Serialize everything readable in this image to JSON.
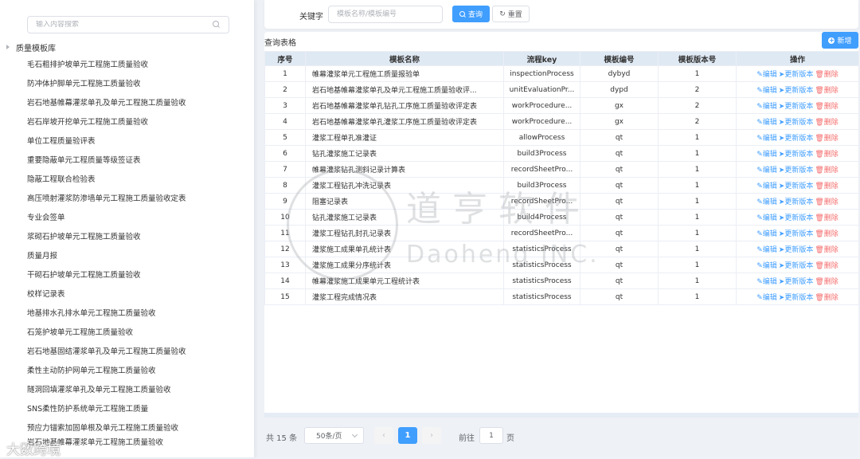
{
  "tree": {
    "search_placeholder": "输入内容搜索",
    "root_label": "质量模板库",
    "items": [
      "毛石粗排护坡单元工程施工质量验收",
      "防冲体护脚单元工程施工质量验收",
      "岩石地基帷幕灌浆单孔及单元工程施工质量验收",
      "岩石岸坡开挖单元工程施工质量验收",
      "单位工程质量验评表",
      "重要隐蔽单元工程质量等级签证表",
      "隐蔽工程联合检验表",
      "高压喷射灌浆防渗墙单元工程施工质量验收定表",
      "专业会签单",
      "浆砌石护坡单元工程施工质量验收",
      "质量月报",
      "干砌石护坡单元工程施工质量验收",
      "校样记录表",
      "地基排水孔排水单元工程施工质量验收",
      "石笼护坡单元工程施工质量验收",
      "岩石地基固结灌浆单孔及单元工程施工质量验收",
      "柔性主动防护网单元工程施工质量验收",
      "隧洞回填灌浆单孔及单元工程施工质量验收",
      "SNS柔性防护系统单元工程施工质量",
      "预应力锚索加固单根及单元工程施工质量验收",
      "岩石地基帷幕灌浆单元工程施工质量验收"
    ]
  },
  "search": {
    "keyword_label": "关键字",
    "keyword_placeholder": "模板名称/模板编号",
    "query_label": "查询",
    "reset_label": "重置"
  },
  "table": {
    "title": "查询表格",
    "add_label": "新增",
    "columns": [
      "序号",
      "模板名称",
      "流程key",
      "模板编号",
      "模板版本号",
      "操作"
    ],
    "actions": {
      "edit": "编辑",
      "update": "更新版本",
      "delete": "删除"
    },
    "rows": [
      [
        "1",
        "帷幕灌浆单元工程施工质量报验单",
        "inspectionProcess",
        "dybyd",
        "1"
      ],
      [
        "2",
        "岩石地基帷幕灌浆单孔及单元工程施工质量验收评...",
        "unitEvaluationPr...",
        "dypd",
        "2"
      ],
      [
        "3",
        "岩石地基帷幕灌浆单孔钻孔工序施工质量验收评定表",
        "workProcedure...",
        "gx",
        "2"
      ],
      [
        "4",
        "岩石地基帷幕灌浆单孔灌浆工序施工质量验收评定表",
        "workProcedure...",
        "gx",
        "2"
      ],
      [
        "5",
        "灌浆工程单孔准灌证",
        "allowProcess",
        "qt",
        "1"
      ],
      [
        "6",
        "钻孔灌浆施工记录表",
        "build3Process",
        "qt",
        "1"
      ],
      [
        "7",
        "帷幕灌浆钻孔测斜记录计算表",
        "recordSheetPro...",
        "qt",
        "1"
      ],
      [
        "8",
        "灌浆工程钻孔冲洗记录表",
        "build3Process",
        "qt",
        "1"
      ],
      [
        "9",
        "阻塞记录表",
        "recordSheetPro...",
        "qt",
        "1"
      ],
      [
        "10",
        "钻孔灌浆施工记录表",
        "build4Process",
        "qt",
        "1"
      ],
      [
        "11",
        "灌浆工程钻孔封孔记录表",
        "recordSheetPro...",
        "qt",
        "1"
      ],
      [
        "12",
        "灌浆施工成果单孔统计表",
        "statisticsProcess",
        "qt",
        "1"
      ],
      [
        "13",
        "灌浆施工成果分序统计表",
        "statisticsProcess",
        "qt",
        "1"
      ],
      [
        "14",
        "帷幕灌浆施工成果单元工程统计表",
        "statisticsProcess",
        "qt",
        "1"
      ],
      [
        "15",
        "灌浆工程完成情况表",
        "statisticsProcess",
        "qt",
        "1"
      ]
    ]
  },
  "pagination": {
    "total": "共 15 条",
    "page_size": "50条/页",
    "current_page": "1",
    "goto_label": "前往",
    "goto_value": "1",
    "goto_suffix": "页"
  },
  "watermark": {
    "cn": "道亨软件",
    "en": "Daoheng INC."
  },
  "overlay_text": "大数跨境",
  "colors": {
    "primary": "#409eff",
    "danger": "#f56c6c",
    "header_bg": "#dfe9f3"
  }
}
